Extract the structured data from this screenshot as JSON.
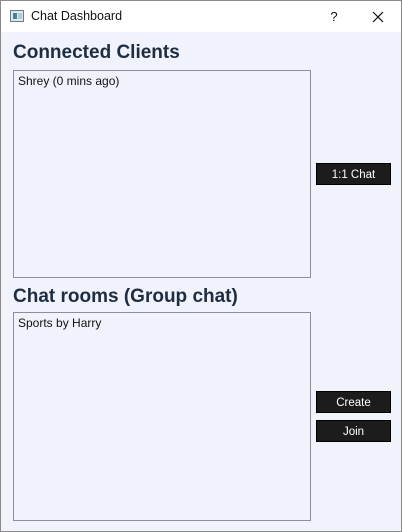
{
  "window": {
    "title": "Chat Dashboard",
    "help_label": "?",
    "icons": {
      "app": "app-window-icon",
      "close": "close-icon"
    }
  },
  "clients": {
    "heading": "Connected Clients",
    "items": [
      "Shrey (0 mins ago)"
    ],
    "chat_button": "1:1 Chat"
  },
  "rooms": {
    "heading": "Chat rooms (Group chat)",
    "items": [
      "Sports by Harry"
    ],
    "create_button": "Create",
    "join_button": "Join"
  },
  "colors": {
    "window_bg": "#f0f3fb",
    "heading_text": "#1e2d40",
    "button_bg": "#1c1c1c",
    "button_text": "#ffffff"
  }
}
